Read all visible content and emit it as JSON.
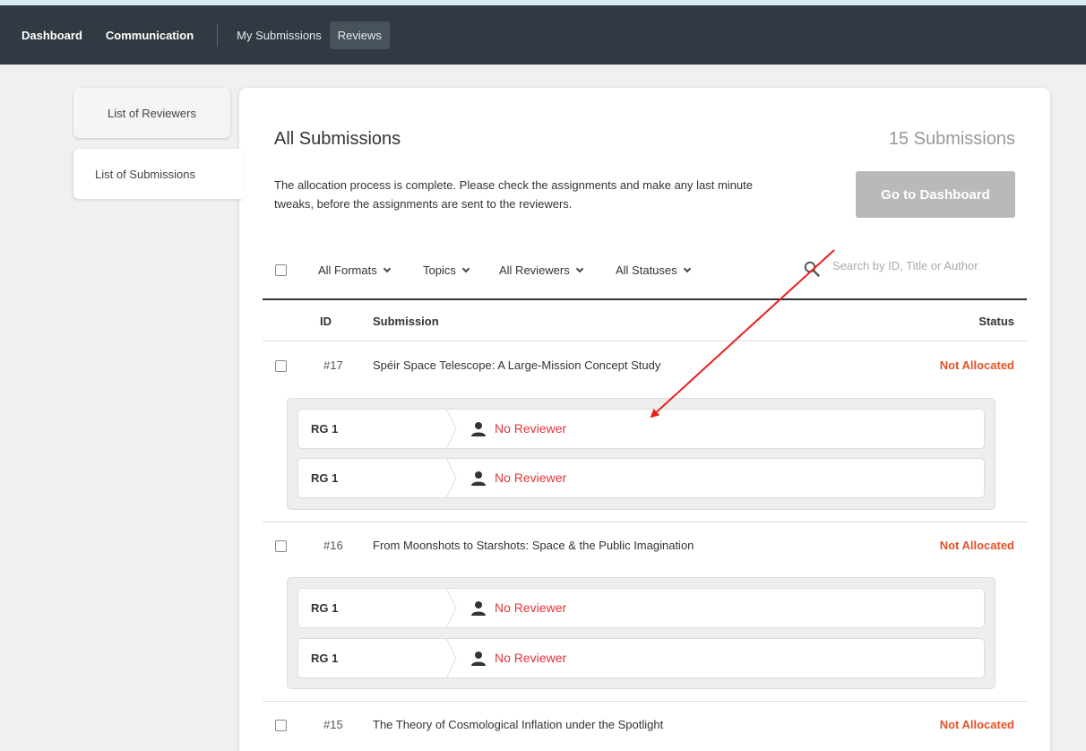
{
  "nav": {
    "main": [
      "Dashboard",
      "Communication"
    ],
    "sub": [
      "My Submissions",
      "Reviews"
    ],
    "active_sub": "Reviews"
  },
  "sidebar": {
    "tabs": [
      "List of Reviewers",
      "List of Submissions"
    ],
    "active": "List of Submissions"
  },
  "panel": {
    "title": "All Submissions",
    "count": "15 Submissions",
    "description": "The allocation process is complete. Please check the assignments and make any last minute tweaks, before the assignments are sent to the reviewers.",
    "dashboard_button": "Go to Dashboard"
  },
  "filters": {
    "formats": "All Formats",
    "topics": "Topics",
    "reviewers": "All Reviewers",
    "statuses": "All Statuses",
    "search_placeholder": "Search by ID, Title or Author"
  },
  "table": {
    "headers": {
      "id": "ID",
      "submission": "Submission",
      "status": "Status"
    },
    "rows": [
      {
        "id": "#17",
        "title": "Spéir Space Telescope: A Large-Mission Concept Study",
        "status": "Not Allocated",
        "assignments": [
          {
            "group": "RG 1",
            "reviewer": "No Reviewer"
          },
          {
            "group": "RG 1",
            "reviewer": "No Reviewer"
          }
        ]
      },
      {
        "id": "#16",
        "title": "From Moonshots to Starshots: Space & the Public Imagination",
        "status": "Not Allocated",
        "assignments": [
          {
            "group": "RG 1",
            "reviewer": "No Reviewer"
          },
          {
            "group": "RG 1",
            "reviewer": "No Reviewer"
          }
        ]
      },
      {
        "id": "#15",
        "title": "The Theory of Cosmological Inflation under the Spotlight",
        "status": "Not Allocated",
        "assignments": []
      }
    ]
  },
  "colors": {
    "navbar": "#313a42",
    "status_not_allocated": "#e0532a",
    "no_reviewer": "#e0353a",
    "annotation_arrow": "#e8201c"
  },
  "icons": {
    "search": "search-icon",
    "person": "person-icon",
    "chevron": "chevron-down-icon"
  }
}
